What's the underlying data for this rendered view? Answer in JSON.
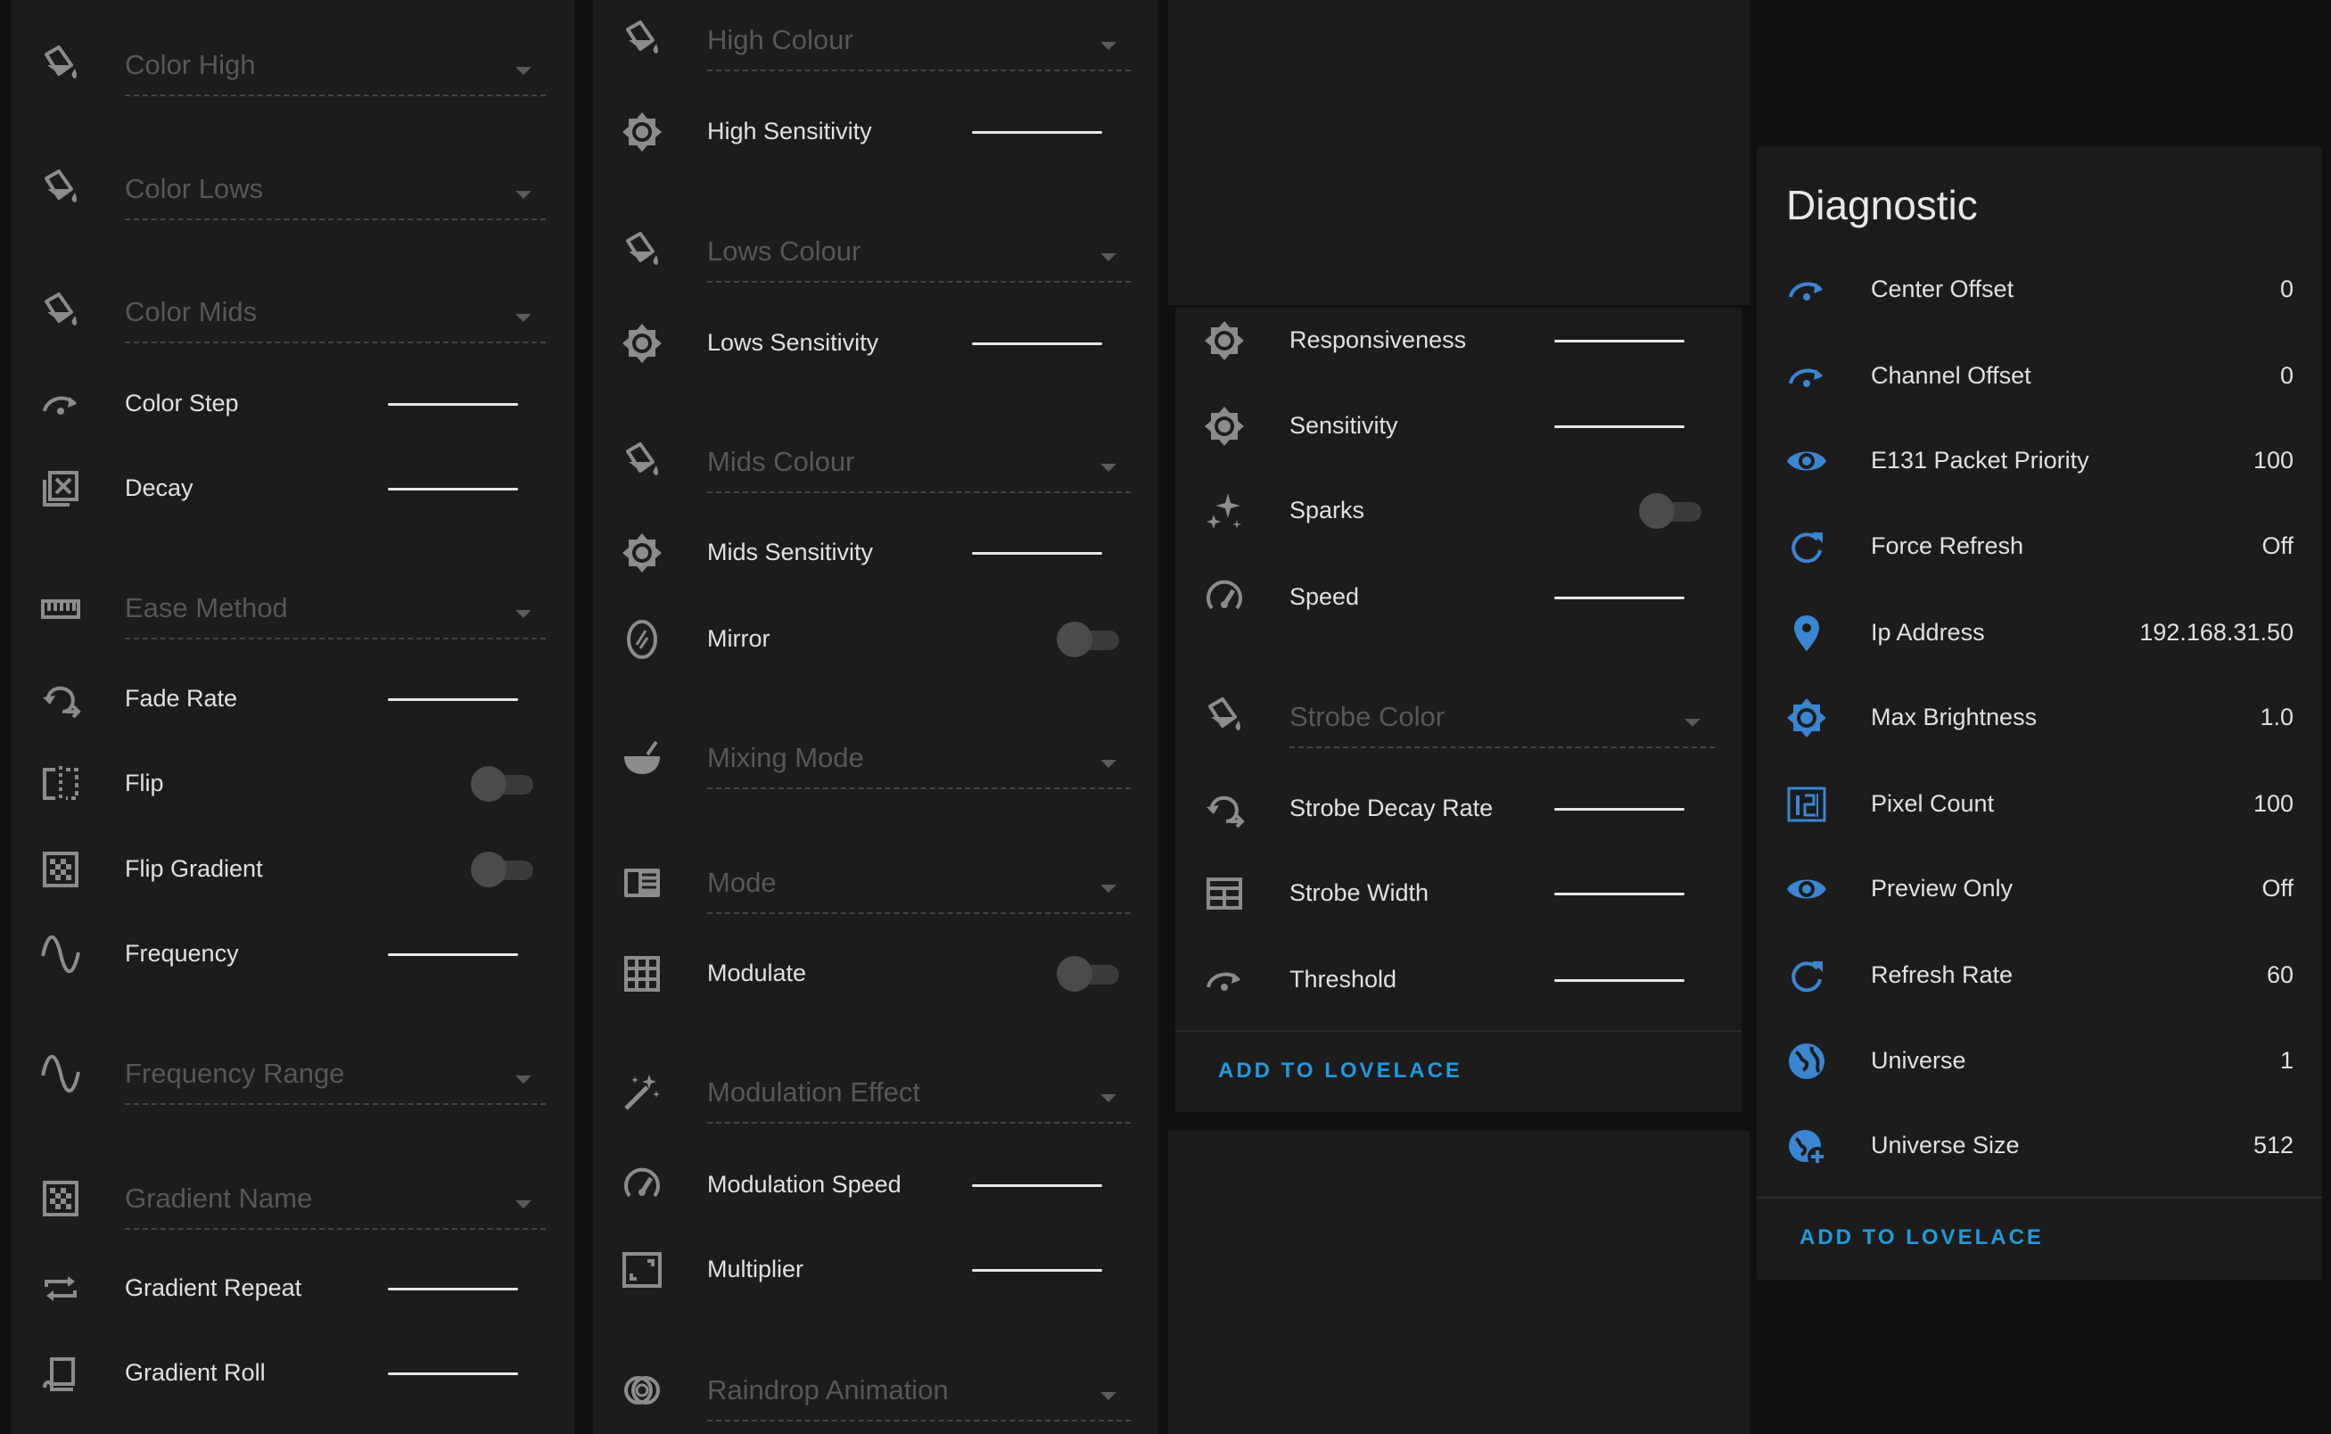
{
  "colors": {
    "background": "#111111",
    "card": "#1c1c1c",
    "accent": "#1e9bdf",
    "diagnostic_icon": "#3b86d1",
    "control_icon": "#8c8c8c"
  },
  "col1": {
    "items": [
      {
        "label": "Color High",
        "kind": "select",
        "icon": "paint-bucket-icon"
      },
      {
        "label": "Color Lows",
        "kind": "select",
        "icon": "paint-bucket-icon"
      },
      {
        "label": "Color Mids",
        "kind": "select",
        "icon": "paint-bucket-icon"
      },
      {
        "label": "Color Step",
        "kind": "slider",
        "icon": "rotate-arrow-icon"
      },
      {
        "label": "Decay",
        "kind": "slider",
        "icon": "square-x-icon"
      },
      {
        "label": "Ease Method",
        "kind": "select",
        "icon": "ruler-icon"
      },
      {
        "label": "Fade Rate",
        "kind": "slider",
        "icon": "rotate-left-icon"
      },
      {
        "label": "Flip",
        "kind": "toggle",
        "icon": "flip-horizontal-icon"
      },
      {
        "label": "Flip Gradient",
        "kind": "toggle",
        "icon": "checkerboard-icon"
      },
      {
        "label": "Frequency",
        "kind": "slider",
        "icon": "sine-wave-icon"
      },
      {
        "label": "Frequency Range",
        "kind": "select",
        "icon": "sine-wave-icon"
      },
      {
        "label": "Gradient Name",
        "kind": "select",
        "icon": "checkerboard-icon"
      },
      {
        "label": "Gradient Repeat",
        "kind": "slider",
        "icon": "repeat-icon"
      },
      {
        "label": "Gradient Roll",
        "kind": "slider",
        "icon": "roll-icon"
      }
    ]
  },
  "col2": {
    "items": [
      {
        "label": "High Colour",
        "kind": "select",
        "icon": "paint-bucket-icon"
      },
      {
        "label": "High Sensitivity",
        "kind": "slider",
        "icon": "brightness-icon"
      },
      {
        "label": "Lows Colour",
        "kind": "select",
        "icon": "paint-bucket-icon"
      },
      {
        "label": "Lows Sensitivity",
        "kind": "slider",
        "icon": "brightness-icon"
      },
      {
        "label": "Mids Colour",
        "kind": "select",
        "icon": "paint-bucket-icon"
      },
      {
        "label": "Mids Sensitivity",
        "kind": "slider",
        "icon": "brightness-icon"
      },
      {
        "label": "Mirror",
        "kind": "toggle",
        "icon": "mirror-icon"
      },
      {
        "label": "Mixing Mode",
        "kind": "select",
        "icon": "bowl-mix-icon"
      },
      {
        "label": "Mode",
        "kind": "select",
        "icon": "card-text-icon"
      },
      {
        "label": "Modulate",
        "kind": "toggle",
        "icon": "grid-icon"
      },
      {
        "label": "Modulation Effect",
        "kind": "select",
        "icon": "magic-wand-icon"
      },
      {
        "label": "Modulation Speed",
        "kind": "slider",
        "icon": "speedometer-icon"
      },
      {
        "label": "Multiplier",
        "kind": "slider",
        "icon": "resize-icon"
      },
      {
        "label": "Raindrop Animation",
        "kind": "select",
        "icon": "rings-icon"
      }
    ]
  },
  "col3": {
    "items": [
      {
        "label": "Responsiveness",
        "kind": "slider",
        "icon": "brightness-icon"
      },
      {
        "label": "Sensitivity",
        "kind": "slider",
        "icon": "brightness-icon"
      },
      {
        "label": "Sparks",
        "kind": "toggle",
        "icon": "sparkles-icon"
      },
      {
        "label": "Speed",
        "kind": "slider",
        "icon": "speedometer-icon"
      },
      {
        "label": "Strobe Color",
        "kind": "select",
        "icon": "paint-bucket-icon"
      },
      {
        "label": "Strobe Decay Rate",
        "kind": "slider",
        "icon": "rotate-left-icon"
      },
      {
        "label": "Strobe Width",
        "kind": "slider",
        "icon": "table-icon"
      },
      {
        "label": "Threshold",
        "kind": "slider",
        "icon": "rotate-arrow-icon"
      }
    ],
    "action": "ADD TO LOVELACE"
  },
  "diagnostic": {
    "title": "Diagnostic",
    "items": [
      {
        "label": "Center Offset",
        "value": "0",
        "icon": "rotate-arrow-icon"
      },
      {
        "label": "Channel Offset",
        "value": "0",
        "icon": "rotate-arrow-icon"
      },
      {
        "label": "E131 Packet Priority",
        "value": "100",
        "icon": "eye-icon"
      },
      {
        "label": "Force Refresh",
        "value": "Off",
        "icon": "refresh-icon"
      },
      {
        "label": "Ip Address",
        "value": "192.168.31.50",
        "icon": "map-marker-icon"
      },
      {
        "label": "Max Brightness",
        "value": "1.0",
        "icon": "brightness-icon"
      },
      {
        "label": "Pixel Count",
        "value": "100",
        "icon": "numeric-icon"
      },
      {
        "label": "Preview Only",
        "value": "Off",
        "icon": "eye-icon"
      },
      {
        "label": "Refresh Rate",
        "value": "60",
        "icon": "refresh-icon"
      },
      {
        "label": "Universe",
        "value": "1",
        "icon": "earth-icon"
      },
      {
        "label": "Universe Size",
        "value": "512",
        "icon": "earth-plus-icon"
      }
    ],
    "action": "ADD TO LOVELACE"
  }
}
